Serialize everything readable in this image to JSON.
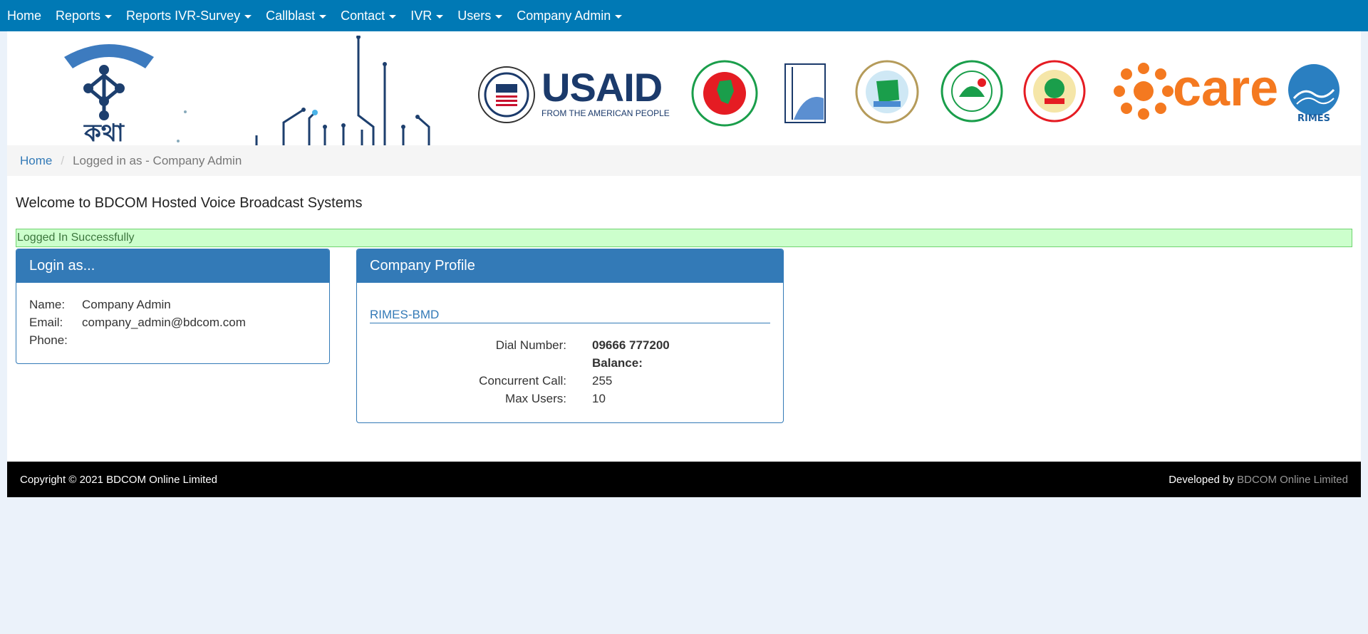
{
  "nav": {
    "color": "#0079b5",
    "items": [
      {
        "label": "Home",
        "dropdown": false
      },
      {
        "label": "Reports",
        "dropdown": true
      },
      {
        "label": "Reports IVR-Survey",
        "dropdown": true
      },
      {
        "label": "Callblast",
        "dropdown": true
      },
      {
        "label": "Contact",
        "dropdown": true
      },
      {
        "label": "IVR",
        "dropdown": true
      },
      {
        "label": "Users",
        "dropdown": true
      },
      {
        "label": "Company Admin",
        "dropdown": true
      }
    ]
  },
  "banner": {
    "logo_text": "কথা",
    "usaid_text": "USAID",
    "usaid_tagline": "FROM THE AMERICAN PEOPLE",
    "care_text": "care",
    "rimes_text": "RIMES"
  },
  "breadcrumb": {
    "home": "Home",
    "separator": "/",
    "active": "Logged in as - Company Admin"
  },
  "welcome": "Welcome to BDCOM Hosted Voice Broadcast Systems",
  "alert": "Logged In Successfully",
  "login_panel": {
    "title": "Login as...",
    "name_label": "Name:",
    "name_value": "Company Admin",
    "email_label": "Email:",
    "email_value": "company_admin@bdcom.com",
    "phone_label": "Phone:",
    "phone_value": ""
  },
  "profile_panel": {
    "title": "Company Profile",
    "company_name": "RIMES-BMD",
    "dial_label": "Dial Number:",
    "dial_value": "09666 777200",
    "balance_label": "Balance:",
    "concurrent_label": "Concurrent Call:",
    "concurrent_value": "255",
    "max_users_label": "Max Users:",
    "max_users_value": "10"
  },
  "footer": {
    "copyright": "Copyright © 2021 BDCOM Online Limited",
    "developed_by": "Developed by",
    "developer": "BDCOM Online Limited"
  }
}
